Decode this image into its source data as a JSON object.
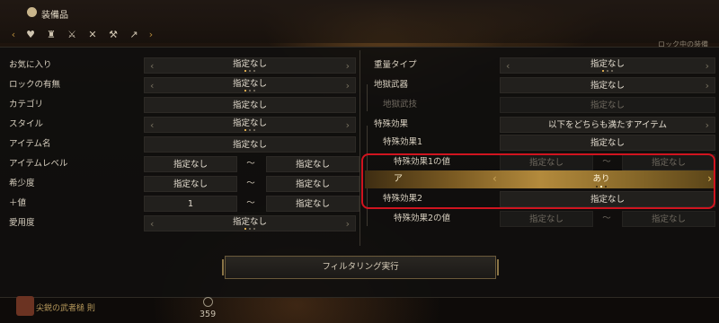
{
  "header": {
    "title": "装備品",
    "icons": [
      "chevron-left-icon",
      "heart-icon",
      "armor-icon",
      "crossed-swords-icon",
      "crossed-blades-icon",
      "tools-icon",
      "spear-icon",
      "chevron-right-icon"
    ],
    "right_text": "ロック中の装備"
  },
  "left": [
    {
      "label": "お気に入り",
      "value": "指定なし",
      "type": "select",
      "dots": [
        true,
        false,
        false
      ]
    },
    {
      "label": "ロックの有無",
      "value": "指定なし",
      "type": "select",
      "dots": [
        true,
        false,
        false
      ]
    },
    {
      "label": "カテゴリ",
      "value": "指定なし",
      "type": "plain"
    },
    {
      "label": "スタイル",
      "value": "指定なし",
      "type": "select",
      "dots": [
        true,
        false,
        false
      ]
    },
    {
      "label": "アイテム名",
      "value": "指定なし",
      "type": "plain"
    },
    {
      "label": "アイテムレベル",
      "from": "指定なし",
      "sep": "〜",
      "to": "指定なし",
      "type": "range"
    },
    {
      "label": "希少度",
      "from": "指定なし",
      "sep": "〜",
      "to": "指定なし",
      "type": "range"
    },
    {
      "label": "＋値",
      "from": "1",
      "sep": "〜",
      "to": "指定なし",
      "type": "range"
    },
    {
      "label": "愛用度",
      "value": "指定なし",
      "type": "select",
      "dots": [
        true,
        false,
        false
      ]
    }
  ],
  "right": {
    "weight_type": {
      "label": "重量タイプ",
      "value": "指定なし",
      "dots": [
        true,
        false,
        false
      ]
    },
    "hell_weapon": {
      "label": "地獄武器",
      "value": "指定なし"
    },
    "hell_skill": {
      "label": "地獄武技",
      "value": "指定なし"
    },
    "special_effect": {
      "label": "特殊効果",
      "value": "以下をどちらも満たすアイテム"
    },
    "effect1": {
      "label": "特殊効果1",
      "value": "指定なし"
    },
    "effect1_value": {
      "label": "特殊効果1の値",
      "from": "指定なし",
      "sep": "〜",
      "to": "指定なし"
    },
    "highlighted": {
      "label": "ア",
      "value": "あり",
      "dots": [
        false,
        true,
        false
      ]
    },
    "effect2": {
      "label": "特殊効果2",
      "value": "指定なし"
    },
    "effect2_value": {
      "label": "特殊効果2の値",
      "from": "指定なし",
      "sep": "〜",
      "to": "指定なし"
    }
  },
  "footer": {
    "execute_label": "フィルタリング実行",
    "item_name": "尖鋭の武者槌 則",
    "count": "359"
  }
}
